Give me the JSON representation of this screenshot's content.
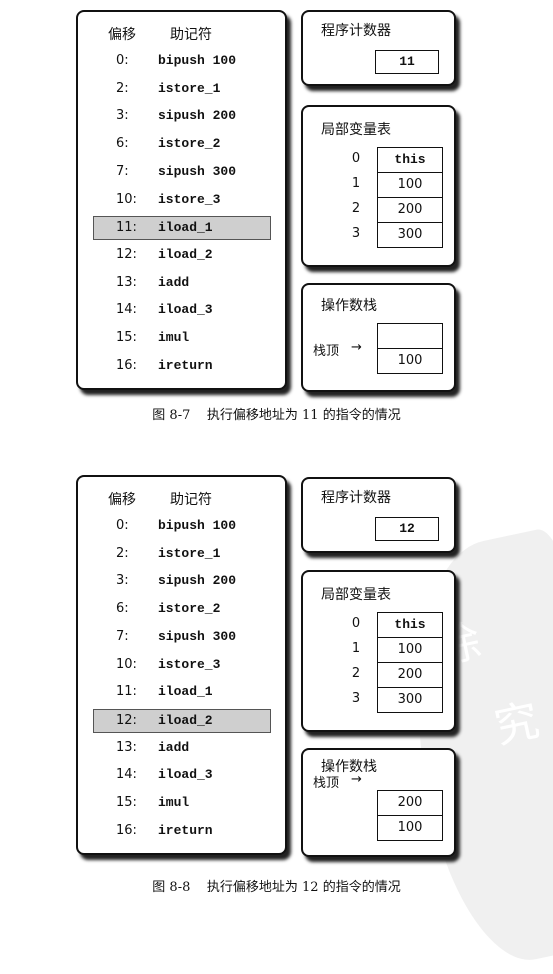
{
  "figures": [
    {
      "id_label": "图 8-7",
      "caption": "图 8-7    执行偏移地址为 11 的指令的情况",
      "code_table": {
        "header_offset": "偏移",
        "header_mnemonic": "助记符",
        "highlighted_offset": "11",
        "rows": [
          {
            "offset": "0:",
            "mnemonic": "bipush  100"
          },
          {
            "offset": "2:",
            "mnemonic": "istore_1"
          },
          {
            "offset": "3:",
            "mnemonic": "sipush  200"
          },
          {
            "offset": "6:",
            "mnemonic": "istore_2"
          },
          {
            "offset": "7:",
            "mnemonic": "sipush  300"
          },
          {
            "offset": "10:",
            "mnemonic": "istore_3"
          },
          {
            "offset": "11:",
            "mnemonic": "iload_1"
          },
          {
            "offset": "12:",
            "mnemonic": "iload_2"
          },
          {
            "offset": "13:",
            "mnemonic": "iadd"
          },
          {
            "offset": "14:",
            "mnemonic": "iload_3"
          },
          {
            "offset": "15:",
            "mnemonic": "imul"
          },
          {
            "offset": "16:",
            "mnemonic": "ireturn"
          }
        ]
      },
      "program_counter": {
        "title": "程序计数器",
        "value": "11"
      },
      "local_variables": {
        "title": "局部变量表",
        "slots": [
          {
            "index": "0",
            "value": "this"
          },
          {
            "index": "1",
            "value": "100"
          },
          {
            "index": "2",
            "value": "200"
          },
          {
            "index": "3",
            "value": "300"
          }
        ]
      },
      "operand_stack": {
        "title": "操作数栈",
        "top_label": "栈顶",
        "arrow": "→",
        "cells": [
          "",
          "100"
        ]
      }
    },
    {
      "id_label": "图 8-8",
      "caption": "图 8-8    执行偏移地址为 12 的指令的情况",
      "code_table": {
        "header_offset": "偏移",
        "header_mnemonic": "助记符",
        "highlighted_offset": "12",
        "rows": [
          {
            "offset": "0:",
            "mnemonic": "bipush  100"
          },
          {
            "offset": "2:",
            "mnemonic": "istore_1"
          },
          {
            "offset": "3:",
            "mnemonic": "sipush  200"
          },
          {
            "offset": "6:",
            "mnemonic": "istore_2"
          },
          {
            "offset": "7:",
            "mnemonic": "sipush  300"
          },
          {
            "offset": "10:",
            "mnemonic": "istore_3"
          },
          {
            "offset": "11:",
            "mnemonic": "iload_1"
          },
          {
            "offset": "12:",
            "mnemonic": "iload_2"
          },
          {
            "offset": "13:",
            "mnemonic": "iadd"
          },
          {
            "offset": "14:",
            "mnemonic": "iload_3"
          },
          {
            "offset": "15:",
            "mnemonic": "imul"
          },
          {
            "offset": "16:",
            "mnemonic": "ireturn"
          }
        ]
      },
      "program_counter": {
        "title": "程序计数器",
        "value": "12"
      },
      "local_variables": {
        "title": "局部变量表",
        "slots": [
          {
            "index": "0",
            "value": "this"
          },
          {
            "index": "1",
            "value": "100"
          },
          {
            "index": "2",
            "value": "200"
          },
          {
            "index": "3",
            "value": "300"
          }
        ]
      },
      "operand_stack": {
        "title": "操作数栈",
        "top_label": "栈顶",
        "arrow": "→",
        "cells": [
          "200",
          "100"
        ]
      }
    }
  ],
  "watermark": {
    "glyphs": [
      "徐",
      "究"
    ]
  }
}
